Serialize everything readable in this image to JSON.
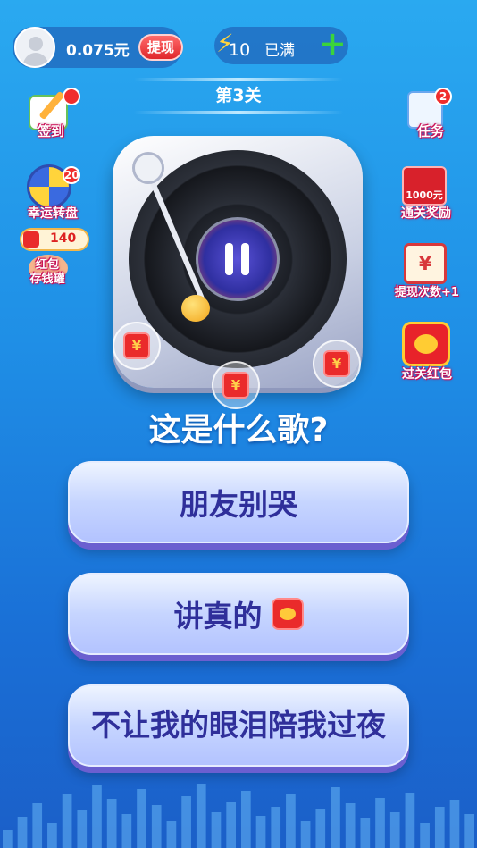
{
  "header": {
    "balance": "0.075元",
    "withdraw_label": "提现",
    "energy_count": "10",
    "energy_status": "已满",
    "plus_label": "+"
  },
  "level": "第3关",
  "left_side": {
    "checkin_label": "签到",
    "wheel_label": "幸运转盘",
    "wheel_badge": "20",
    "piggy_count": "140",
    "piggy_label_1": "红包",
    "piggy_label_2": "存钱罐"
  },
  "right_side": {
    "task_label": "任务",
    "task_badge": "2",
    "reward_amount": "1000元",
    "reward_label": "通关奖励",
    "withdraw_times_label": "提现次数+1",
    "level_packet_label": "过关红包"
  },
  "player": {
    "yuan_symbol": "¥"
  },
  "question": "这是什么歌?",
  "answers": [
    {
      "text": "朋友别哭",
      "has_redpacket": false
    },
    {
      "text": "讲真的",
      "has_redpacket": true
    },
    {
      "text": "不让我的眼泪陪我过夜",
      "has_redpacket": false
    }
  ],
  "colors": {
    "accent_red": "#ea2b2b",
    "answer_text": "#2f2f9a",
    "bg_top": "#2aa9f0",
    "bg_bottom": "#1b5fc8"
  }
}
